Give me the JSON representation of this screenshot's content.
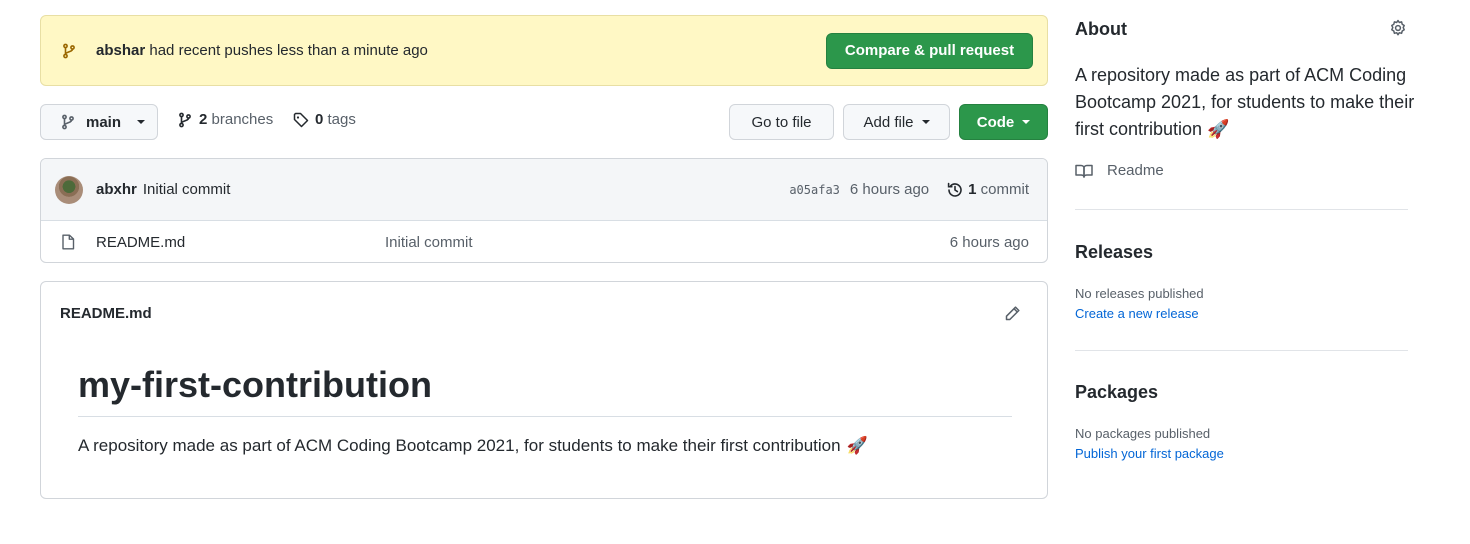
{
  "banner": {
    "user": "abshar",
    "message": "had recent pushes less than a minute ago",
    "button_label": "Compare & pull request"
  },
  "toolbar": {
    "branch": "main",
    "branches_count": "2",
    "branches_label": "branches",
    "tags_count": "0",
    "tags_label": "tags",
    "goto_label": "Go to file",
    "add_label": "Add file",
    "code_label": "Code"
  },
  "commit": {
    "author": "abxhr",
    "message": "Initial commit",
    "sha": "a05afa3",
    "time": "6 hours ago",
    "count": "1",
    "count_label": "commit"
  },
  "files": [
    {
      "name": "README.md",
      "message": "Initial commit",
      "age": "6 hours ago",
      "icon": "file-icon"
    }
  ],
  "readme": {
    "filename": "README.md",
    "heading": "my-first-contribution",
    "body": "A repository made as part of ACM Coding Bootcamp 2021, for students to make their first contribution",
    "emoji": "🚀"
  },
  "sidebar": {
    "about_title": "About",
    "about_desc": "A repository made as part of ACM Coding Bootcamp 2021, for students to make their first contribution",
    "readme_label": "Readme",
    "releases_title": "Releases",
    "releases_empty": "No releases published",
    "releases_link": "Create a new release",
    "packages_title": "Packages",
    "packages_empty": "No packages published",
    "packages_link": "Publish your first package"
  },
  "colors": {
    "banner_bg": "#fff8c5",
    "primary_green": "#2c974b",
    "link_blue": "#0366d6"
  }
}
